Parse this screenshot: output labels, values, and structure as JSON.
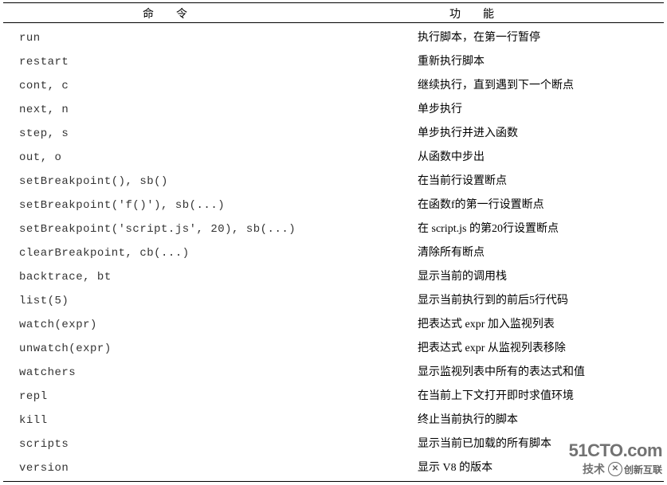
{
  "header": {
    "col1": "命令",
    "col2": "功能"
  },
  "rows": [
    {
      "cmd": "run",
      "desc": "执行脚本，在第一行暂停"
    },
    {
      "cmd": "restart",
      "desc": "重新执行脚本"
    },
    {
      "cmd": "cont, c",
      "desc": "继续执行，直到遇到下一个断点"
    },
    {
      "cmd": "next, n",
      "desc": "单步执行"
    },
    {
      "cmd": "step, s",
      "desc": "单步执行并进入函数"
    },
    {
      "cmd": "out, o",
      "desc": "从函数中步出"
    },
    {
      "cmd": "setBreakpoint(), sb()",
      "desc": "在当前行设置断点"
    },
    {
      "cmd": "setBreakpoint('f()'), sb(...)",
      "desc": "在函数f的第一行设置断点"
    },
    {
      "cmd": "setBreakpoint('script.js', 20), sb(...)",
      "desc": "在 script.js 的第20行设置断点"
    },
    {
      "cmd": "clearBreakpoint, cb(...)",
      "desc": "清除所有断点"
    },
    {
      "cmd": "backtrace, bt",
      "desc": "显示当前的调用栈"
    },
    {
      "cmd": "list(5)",
      "desc": "显示当前执行到的前后5行代码"
    },
    {
      "cmd": "watch(expr)",
      "desc": "把表达式 expr 加入监视列表"
    },
    {
      "cmd": "unwatch(expr)",
      "desc": "把表达式 expr 从监视列表移除"
    },
    {
      "cmd": "watchers",
      "desc": "显示监视列表中所有的表达式和值"
    },
    {
      "cmd": "repl",
      "desc": "在当前上下文打开即时求值环境"
    },
    {
      "cmd": "kill",
      "desc": "终止当前执行的脚本"
    },
    {
      "cmd": "scripts",
      "desc": "显示当前已加载的所有脚本"
    },
    {
      "cmd": "version",
      "desc": "显示 V8 的版本"
    }
  ],
  "watermark": {
    "line1": "51CTO.com",
    "line2": "技术",
    "brand": "创新互联"
  }
}
